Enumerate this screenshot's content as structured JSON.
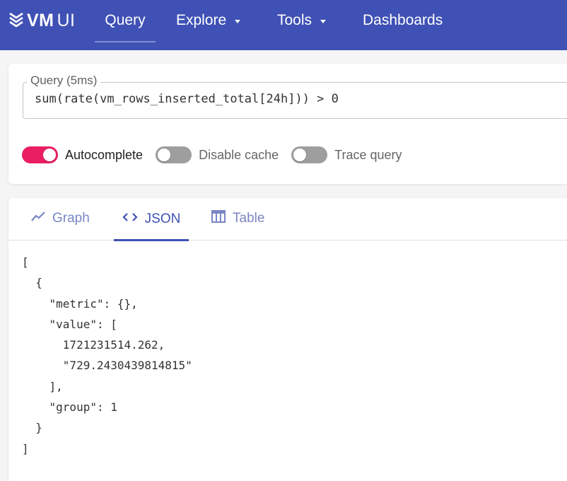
{
  "header": {
    "logo": {
      "vm": "VM",
      "ui": "UI",
      "icon": "vm-logo-icon"
    },
    "nav": [
      {
        "label": "Query",
        "active": true,
        "dropdown": false
      },
      {
        "label": "Explore",
        "active": false,
        "dropdown": true
      },
      {
        "label": "Tools",
        "active": false,
        "dropdown": true
      },
      {
        "label": "Dashboards",
        "active": false,
        "dropdown": false
      }
    ]
  },
  "query": {
    "legend": "Query (5ms)",
    "value": "sum(rate(vm_rows_inserted_total[24h])) > 0",
    "toggles": [
      {
        "label": "Autocomplete",
        "on": true
      },
      {
        "label": "Disable cache",
        "on": false
      },
      {
        "label": "Trace query",
        "on": false
      }
    ]
  },
  "result": {
    "tabs": [
      {
        "label": "Graph",
        "icon": "line-chart-icon",
        "active": false
      },
      {
        "label": "JSON",
        "icon": "code-icon",
        "active": true
      },
      {
        "label": "Table",
        "icon": "table-icon",
        "active": false
      }
    ],
    "json_text": "[\n  {\n    \"metric\": {},\n    \"value\": [\n      1721231514.262,\n      \"729.2430439814815\"\n    ],\n    \"group\": 1\n  }\n]"
  },
  "colors": {
    "header_bg": "#3F51B5",
    "accent": "#3F51B5",
    "toggle_on": "#E91E63",
    "toggle_off": "#9e9e9e"
  }
}
